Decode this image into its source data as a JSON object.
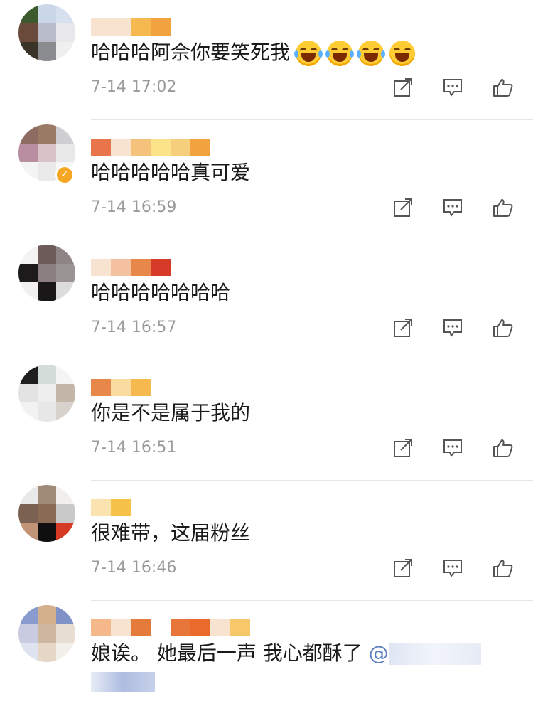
{
  "comments": [
    {
      "username_blocks": [
        "#f7e3cf",
        "#f7e3cf",
        "#f5b94f",
        "#f2a23f"
      ],
      "avatar": [
        "#3c5a2e",
        "#c9d7e8",
        "#d6e0ee",
        "#6a4a3a",
        "#b7bcc8",
        "#e8e8ec",
        "#3a3328",
        "#8a8c8f",
        "#efefef"
      ],
      "verified": false,
      "text": "哈哈哈阿佘你要笑死我",
      "emojis": [
        "laugh-cry-emoji",
        "laugh-cry-emoji",
        "laugh-cry-emoji",
        "laughing-emoji"
      ],
      "time": "7-14 17:02"
    },
    {
      "username_blocks": [
        "#e8764a",
        "#f7e3cf",
        "#f4c27a",
        "#fbe38a",
        "#f6cf7c",
        "#f2a23f"
      ],
      "avatar": [
        "#8e6b63",
        "#9b7b66",
        "#cfcfd1",
        "#b88ea0",
        "#d9c3c8",
        "#e8e8e8",
        "#f4f4f4",
        "#eaeaea",
        "#f7f7f7"
      ],
      "verified": true,
      "text": "哈哈哈哈哈真可爱",
      "emojis": [],
      "time": "7-14 16:59"
    },
    {
      "username_blocks": [
        "#f7e3cf",
        "#f3c0a0",
        "#e8874a",
        "#d83a2a"
      ],
      "avatar": [
        "#f3f3f3",
        "#6e5c5a",
        "#8d8584",
        "#1d1a1b",
        "#8b7f80",
        "#9a9494",
        "#f0f0f0",
        "#1a1718",
        "#dcdcdc"
      ],
      "verified": false,
      "text": "哈哈哈哈哈哈哈",
      "emojis": [],
      "time": "7-14 16:57"
    },
    {
      "username_blocks": [
        "#e8874a",
        "#fbdca0",
        "#f5b94f"
      ],
      "avatar": [
        "#1f1f1f",
        "#d2dcd8",
        "#f4f4f4",
        "#e3e3e3",
        "#eeeeef",
        "#c2b7a8",
        "#f2f2f2",
        "#e7e7e7",
        "#d7d2cc"
      ],
      "verified": false,
      "text": "你是不是属于我的",
      "emojis": [],
      "time": "7-14 16:51"
    },
    {
      "username_blocks": [
        "#fbe3b0",
        "#f7c24a"
      ],
      "avatar": [
        "#e9e9e9",
        "#a08a78",
        "#f0efee",
        "#7b6152",
        "#8a6a52",
        "#c9c9c9",
        "#c19478",
        "#0f0f0f",
        "#d63a25"
      ],
      "verified": false,
      "text": "很难带，这届粉丝",
      "emojis": [],
      "time": "7-14 16:46"
    },
    {
      "username_blocks": [
        "#f5b88a",
        "#f7e3cf",
        "#e57b3a",
        "#ffffff",
        "#e8763a",
        "#e96a2a",
        "#f7e3cf",
        "#f7c86a"
      ],
      "avatar": [
        "#8a9bd0",
        "#d4b08c",
        "#7f92c8",
        "#c9cce0",
        "#cdb7a0",
        "#e8ddd2",
        "#dfe3ef",
        "#e6d6c6",
        "#f3efea"
      ],
      "verified": false,
      "text": "娘诶。 她最后一声 我心都酥了",
      "mention": "@",
      "emojis": [],
      "time": ""
    }
  ],
  "actions": [
    "share-icon",
    "reply-icon",
    "like-icon"
  ]
}
